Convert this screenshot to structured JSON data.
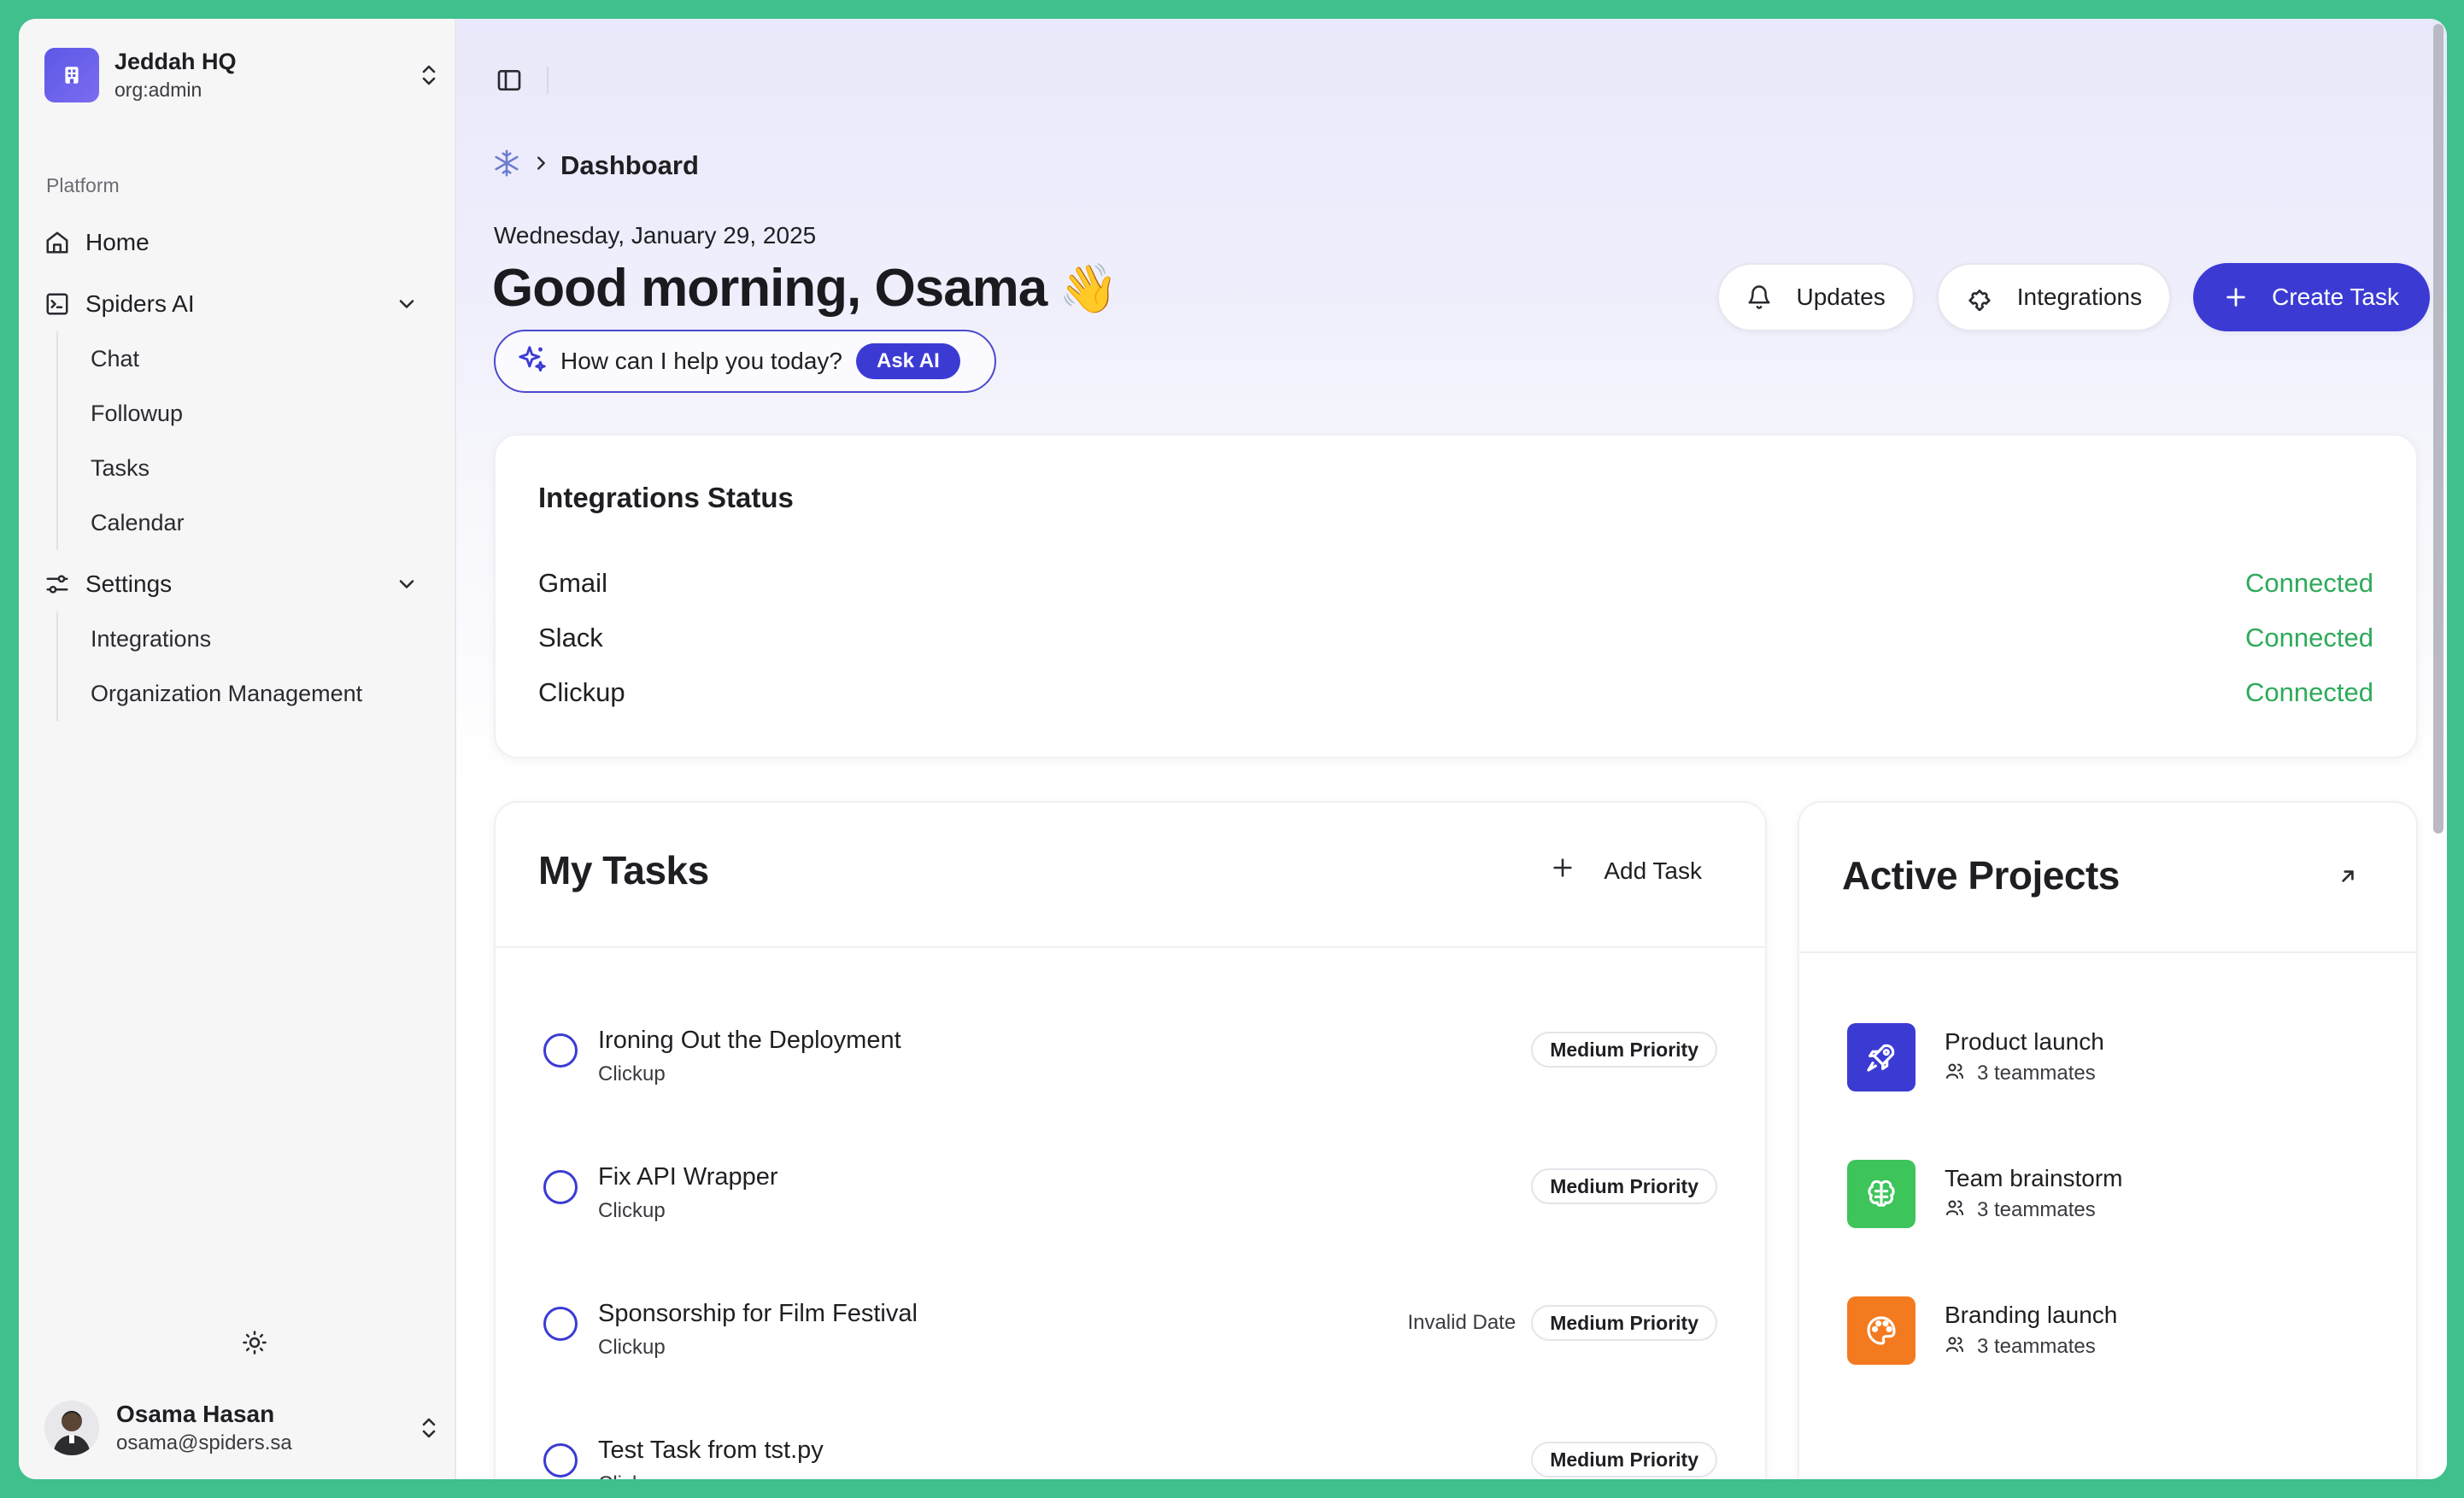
{
  "org": {
    "name": "Jeddah HQ",
    "role": "org:admin"
  },
  "sidebar": {
    "section_label": "Platform",
    "home_label": "Home",
    "spiders_ai": {
      "label": "Spiders AI",
      "items": [
        "Chat",
        "Followup",
        "Tasks",
        "Calendar"
      ]
    },
    "settings": {
      "label": "Settings",
      "items": [
        "Integrations",
        "Organization Management"
      ]
    }
  },
  "user": {
    "name": "Osama Hasan",
    "email": "osama@spiders.sa"
  },
  "breadcrumb": {
    "current": "Dashboard"
  },
  "header": {
    "date": "Wednesday, January 29, 2025",
    "greeting": "Good morning, Osama",
    "wave_emoji": "👋",
    "ask_prompt": "How can I help you today?",
    "ask_button": "Ask AI"
  },
  "actions": {
    "updates": "Updates",
    "integrations": "Integrations",
    "create_task": "Create Task"
  },
  "integrations_status": {
    "title": "Integrations Status",
    "rows": [
      {
        "name": "Gmail",
        "status": "Connected"
      },
      {
        "name": "Slack",
        "status": "Connected"
      },
      {
        "name": "Clickup",
        "status": "Connected"
      }
    ]
  },
  "tasks": {
    "title": "My Tasks",
    "add_label": "Add Task",
    "items": [
      {
        "title": "Ironing Out the Deployment",
        "source": "Clickup",
        "date": "",
        "priority": "Medium Priority"
      },
      {
        "title": "Fix API Wrapper",
        "source": "Clickup",
        "date": "",
        "priority": "Medium Priority"
      },
      {
        "title": "Sponsorship for Film Festival",
        "source": "Clickup",
        "date": "Invalid Date",
        "priority": "Medium Priority"
      },
      {
        "title": "Test Task from tst.py",
        "source": "Clickup",
        "date": "",
        "priority": "Medium Priority"
      }
    ]
  },
  "projects": {
    "title": "Active Projects",
    "items": [
      {
        "name": "Product launch",
        "team": "3 teammates",
        "icon": "rocket-icon",
        "color": "#3b3bd4"
      },
      {
        "name": "Team brainstorm",
        "team": "3 teammates",
        "icon": "brain-icon",
        "color": "#3dc45a"
      },
      {
        "name": "Branding launch",
        "team": "3 teammates",
        "icon": "palette-icon",
        "color": "#f47a1f"
      }
    ]
  },
  "colors": {
    "accent": "#3b3bd4",
    "connected": "#2eaa5a",
    "frame": "#3fc08c"
  }
}
